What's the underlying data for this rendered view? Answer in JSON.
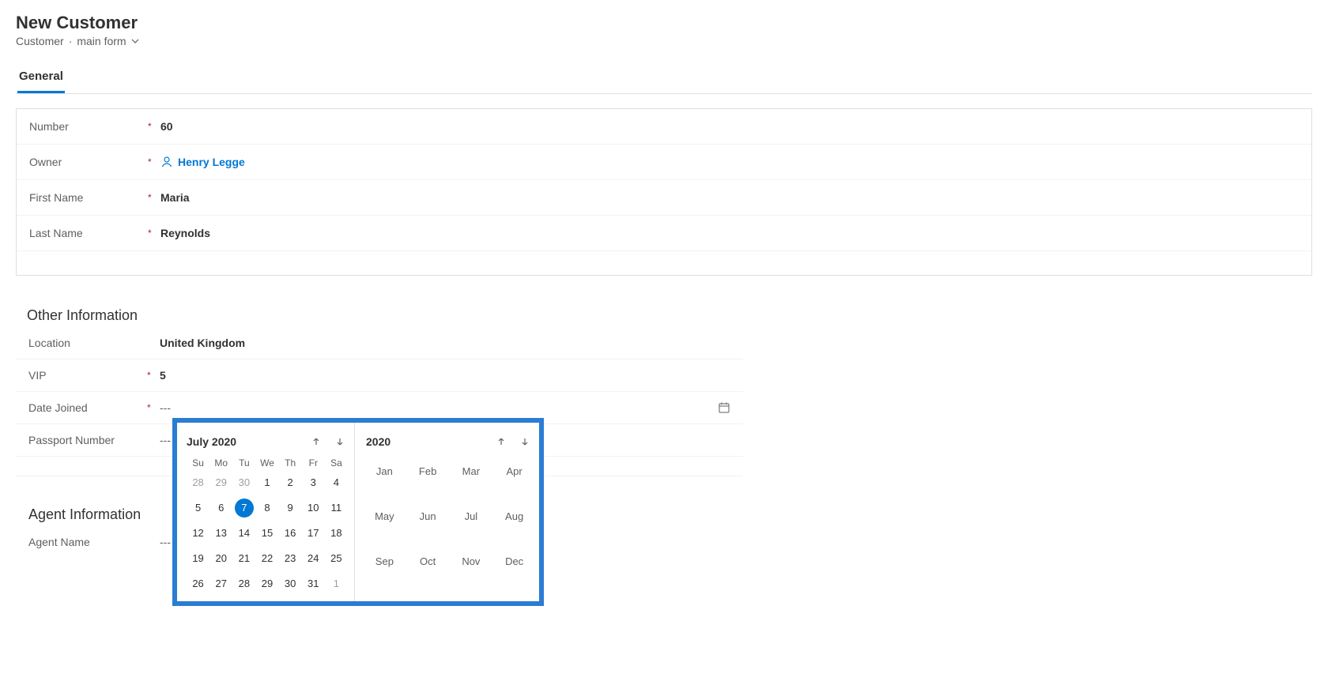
{
  "header": {
    "title": "New Customer",
    "entity": "Customer",
    "form_name": "main form"
  },
  "tabs": {
    "general": "General"
  },
  "fields": {
    "number": {
      "label": "Number",
      "value": "60",
      "required": "*"
    },
    "owner": {
      "label": "Owner",
      "value": "Henry Legge",
      "required": "*"
    },
    "first_name": {
      "label": "First Name",
      "value": "Maria",
      "required": "*"
    },
    "last_name": {
      "label": "Last Name",
      "value": "Reynolds",
      "required": "*"
    }
  },
  "other_info": {
    "title": "Other Information",
    "location": {
      "label": "Location",
      "value": "United Kingdom"
    },
    "vip": {
      "label": "VIP",
      "value": "5",
      "required": "*"
    },
    "date_joined": {
      "label": "Date Joined",
      "value": "---",
      "required": "*"
    },
    "passport_number": {
      "label": "Passport Number",
      "value": "---"
    }
  },
  "agent_info": {
    "title": "Agent Information",
    "agent_name": {
      "label": "Agent Name",
      "value": "---"
    }
  },
  "datepicker": {
    "month_title": "July 2020",
    "year_title": "2020",
    "dow": [
      "Su",
      "Mo",
      "Tu",
      "We",
      "Th",
      "Fr",
      "Sa"
    ],
    "weeks": [
      [
        {
          "d": "28",
          "m": true
        },
        {
          "d": "29",
          "m": true
        },
        {
          "d": "30",
          "m": true
        },
        {
          "d": "1"
        },
        {
          "d": "2"
        },
        {
          "d": "3"
        },
        {
          "d": "4"
        }
      ],
      [
        {
          "d": "5"
        },
        {
          "d": "6"
        },
        {
          "d": "7",
          "sel": true
        },
        {
          "d": "8"
        },
        {
          "d": "9"
        },
        {
          "d": "10"
        },
        {
          "d": "11"
        }
      ],
      [
        {
          "d": "12"
        },
        {
          "d": "13"
        },
        {
          "d": "14"
        },
        {
          "d": "15"
        },
        {
          "d": "16"
        },
        {
          "d": "17"
        },
        {
          "d": "18"
        }
      ],
      [
        {
          "d": "19"
        },
        {
          "d": "20"
        },
        {
          "d": "21"
        },
        {
          "d": "22"
        },
        {
          "d": "23"
        },
        {
          "d": "24"
        },
        {
          "d": "25"
        }
      ],
      [
        {
          "d": "26"
        },
        {
          "d": "27"
        },
        {
          "d": "28"
        },
        {
          "d": "29"
        },
        {
          "d": "30"
        },
        {
          "d": "31"
        },
        {
          "d": "1",
          "m": true
        }
      ]
    ],
    "months": [
      "Jan",
      "Feb",
      "Mar",
      "Apr",
      "May",
      "Jun",
      "Jul",
      "Aug",
      "Sep",
      "Oct",
      "Nov",
      "Dec"
    ]
  }
}
